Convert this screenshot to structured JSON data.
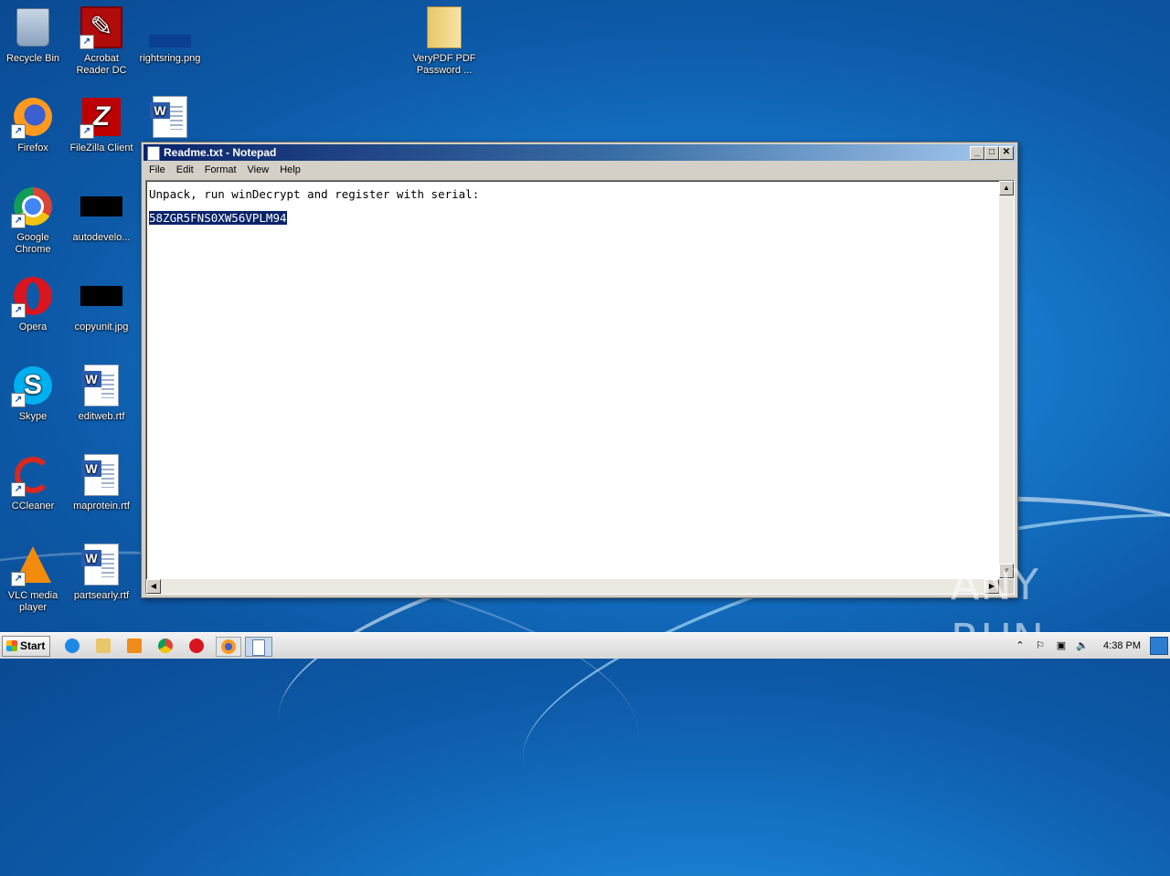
{
  "desktop": {
    "icons": [
      {
        "label": "Recycle Bin"
      },
      {
        "label": "Acrobat Reader DC"
      },
      {
        "label": "rightsring.png"
      },
      {
        "label": "VeryPDF PDF Password ..."
      },
      {
        "label": "Firefox"
      },
      {
        "label": "FileZilla Client"
      },
      {
        "label": "Google Chrome"
      },
      {
        "label": "autodevelo..."
      },
      {
        "label": "Opera"
      },
      {
        "label": "copyunit.jpg"
      },
      {
        "label": "Skype"
      },
      {
        "label": "editweb.rtf"
      },
      {
        "label": "CCleaner"
      },
      {
        "label": "maprotein.rtf"
      },
      {
        "label": "VLC media player"
      },
      {
        "label": "partsearly.rtf"
      }
    ]
  },
  "notepad": {
    "title": "Readme.txt - Notepad",
    "menu": [
      "File",
      "Edit",
      "Format",
      "View",
      "Help"
    ],
    "line1": "Unpack, run winDecrypt and register with serial:",
    "serial": "58ZGR5FNS0XW56VPLM94"
  },
  "watermark": "ANY RUN",
  "taskbar": {
    "start_label": "Start",
    "clock": "4:38 PM"
  },
  "colors": {
    "selection": "#0a246a",
    "titlebar": "#0a246a",
    "desktop": "#1676c9"
  }
}
